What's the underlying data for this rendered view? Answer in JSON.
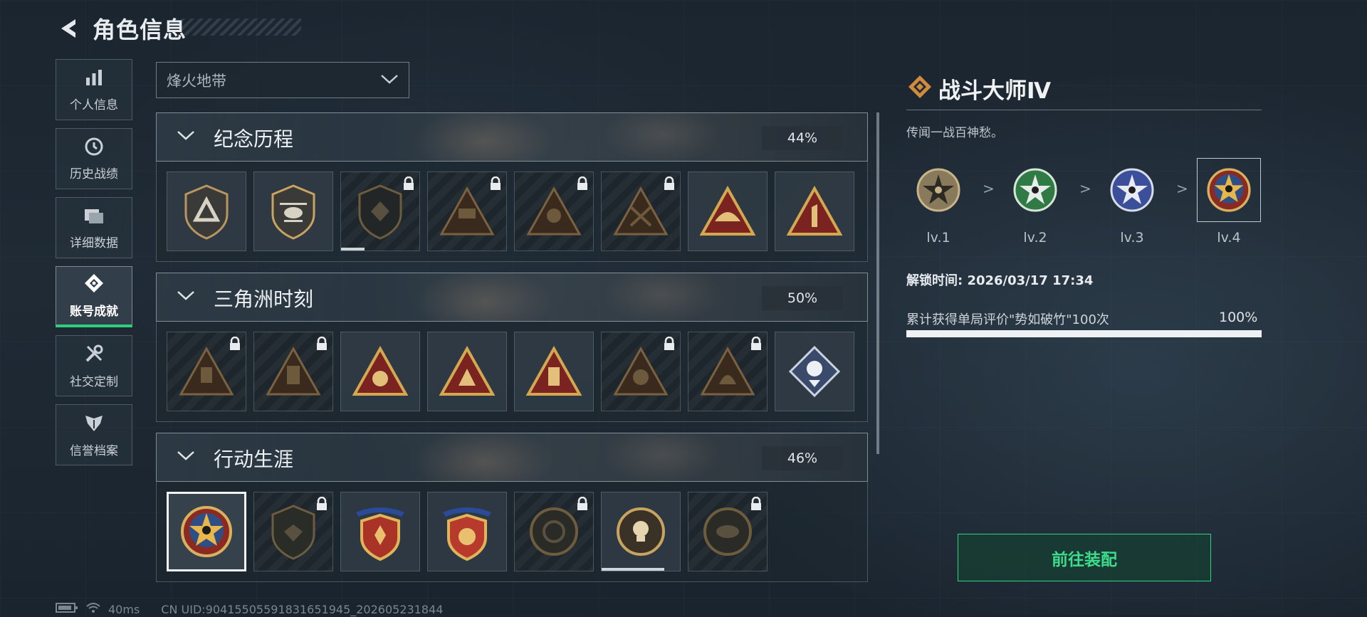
{
  "header": {
    "title": "角色信息"
  },
  "sidenav": {
    "items": [
      {
        "label": "个人信息",
        "icon": "bar-chart-icon"
      },
      {
        "label": "历史战绩",
        "icon": "clock-icon"
      },
      {
        "label": "详细数据",
        "icon": "folder-icon"
      },
      {
        "label": "账号成就",
        "icon": "achievement-icon",
        "active": true
      },
      {
        "label": "社交定制",
        "icon": "tools-icon"
      },
      {
        "label": "信誉档案",
        "icon": "shield-wing-icon"
      }
    ]
  },
  "filter": {
    "selected": "烽火地带"
  },
  "sections": [
    {
      "name": "纪念历程",
      "percent": "44%"
    },
    {
      "name": "三角洲时刻",
      "percent": "50%"
    },
    {
      "name": "行动生涯",
      "percent": "46%"
    }
  ],
  "detail": {
    "title": "战斗大师Ⅳ",
    "description": "传闻一战百神愁。",
    "levels": [
      "lv.1",
      "lv.2",
      "lv.3",
      "lv.4"
    ],
    "unlock_time": "解锁时间: 2026/03/17 17:34",
    "task": "累计获得单局评价\"势如破竹\"100次",
    "task_percent": "100%",
    "task_progress": 1.0,
    "equip_button": "前往装配"
  },
  "status": {
    "ping": "40ms",
    "uid": "CN UID:90415505591831651945_202605231844"
  },
  "colors": {
    "accent": "#2ecf7a",
    "gold": "#c8a460",
    "bronze": "#d08a3a"
  }
}
